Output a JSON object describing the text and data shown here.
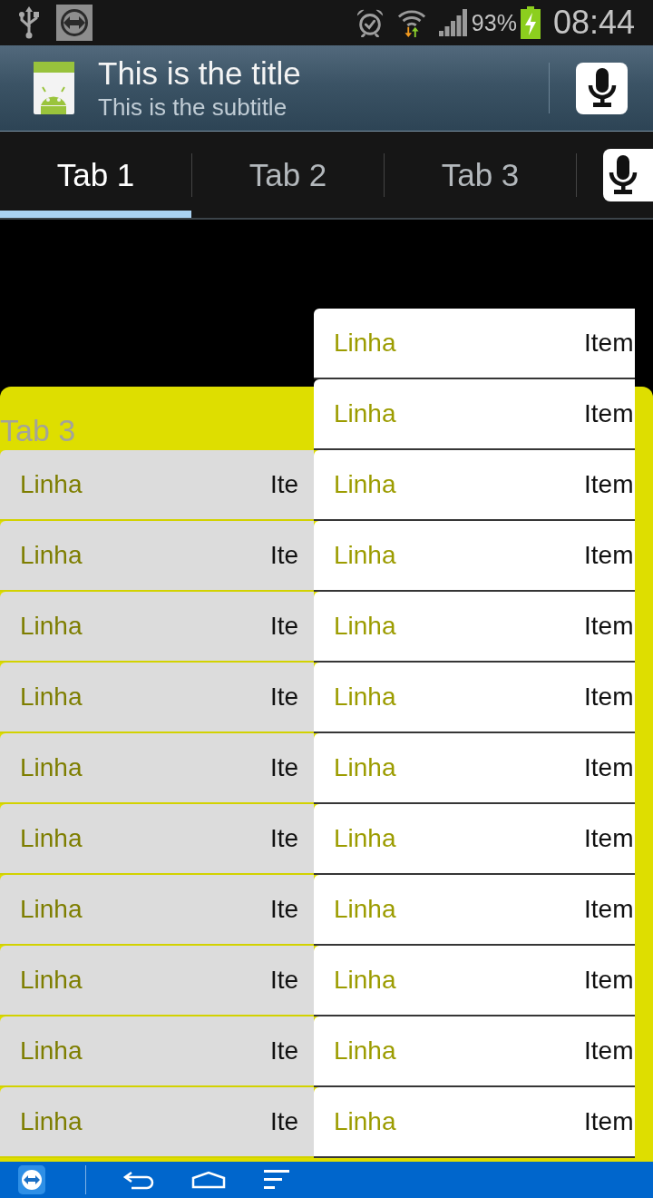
{
  "status_bar": {
    "battery": "93%",
    "time": "08:44"
  },
  "action_bar": {
    "title": "This is the title",
    "subtitle": "This is the subtitle"
  },
  "tabs": [
    {
      "label": "Tab 1",
      "selected": true
    },
    {
      "label": "Tab 2",
      "selected": false
    },
    {
      "label": "Tab 3",
      "selected": false
    }
  ],
  "content": {
    "panel_label": "Tab 3",
    "back_list": [
      {
        "label": "Linha",
        "value": "Ite"
      },
      {
        "label": "Linha",
        "value": "Ite"
      },
      {
        "label": "Linha",
        "value": "Ite"
      },
      {
        "label": "Linha",
        "value": "Ite"
      },
      {
        "label": "Linha",
        "value": "Ite"
      },
      {
        "label": "Linha",
        "value": "Ite"
      },
      {
        "label": "Linha",
        "value": "Ite"
      },
      {
        "label": "Linha",
        "value": "Ite"
      },
      {
        "label": "Linha",
        "value": "Ite"
      },
      {
        "label": "Linha",
        "value": "Ite"
      }
    ],
    "front_list": [
      {
        "label": "Linha",
        "value": "Item"
      },
      {
        "label": "Linha",
        "value": "Item"
      },
      {
        "label": "Linha",
        "value": "Item"
      },
      {
        "label": "Linha",
        "value": "Item"
      },
      {
        "label": "Linha",
        "value": "Item"
      },
      {
        "label": "Linha",
        "value": "Item"
      },
      {
        "label": "Linha",
        "value": "Item"
      },
      {
        "label": "Linha",
        "value": "Item"
      },
      {
        "label": "Linha",
        "value": "Item"
      },
      {
        "label": "Linha",
        "value": "Item"
      },
      {
        "label": "Linha",
        "value": "Item"
      },
      {
        "label": "Linha",
        "value": "Item"
      }
    ]
  }
}
